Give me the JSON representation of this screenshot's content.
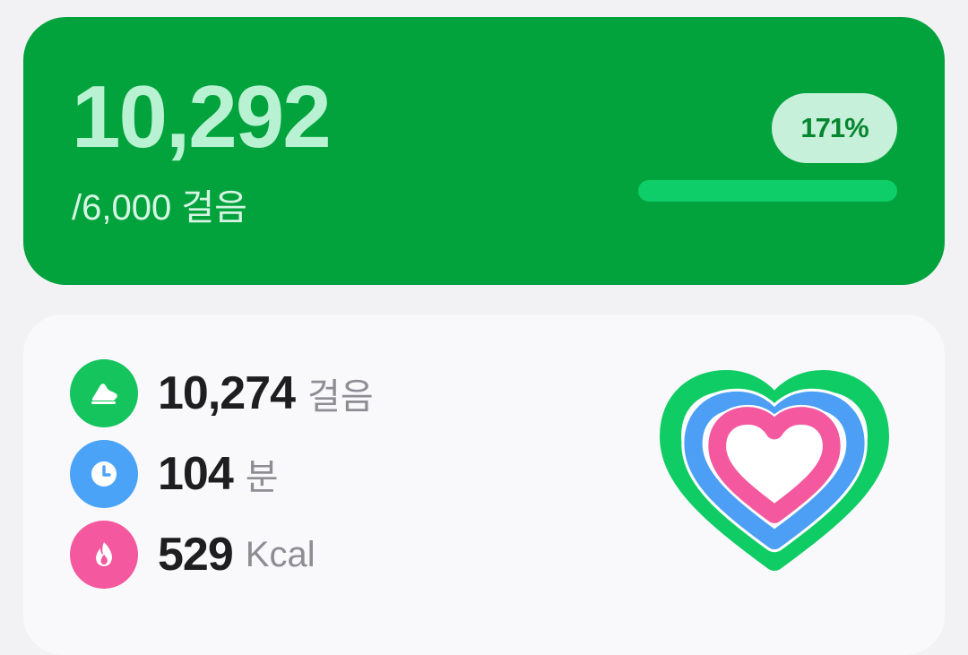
{
  "steps_card": {
    "steps": "10,292",
    "goal": "/6,000 걸음",
    "percent_label": "171%",
    "progress_fraction": 1.0,
    "colors": {
      "background": "#02a23d",
      "steps_text": "#b9f2d2",
      "badge_bg": "#c6f0d9",
      "badge_text": "#06862f",
      "progress": "#0ece69"
    }
  },
  "activity": {
    "rows": [
      {
        "value": "10,274",
        "unit": "걸음",
        "icon": "shoe-icon",
        "color": "#16c45d"
      },
      {
        "value": "104",
        "unit": "분",
        "icon": "clock-icon",
        "color": "#4ba3f7"
      },
      {
        "value": "529",
        "unit": "Kcal",
        "icon": "flame-icon",
        "color": "#f4599f"
      }
    ],
    "heart_rings": {
      "outer": "#10cc64",
      "middle": "#4c9ff5",
      "inner": "#f4599f"
    }
  }
}
